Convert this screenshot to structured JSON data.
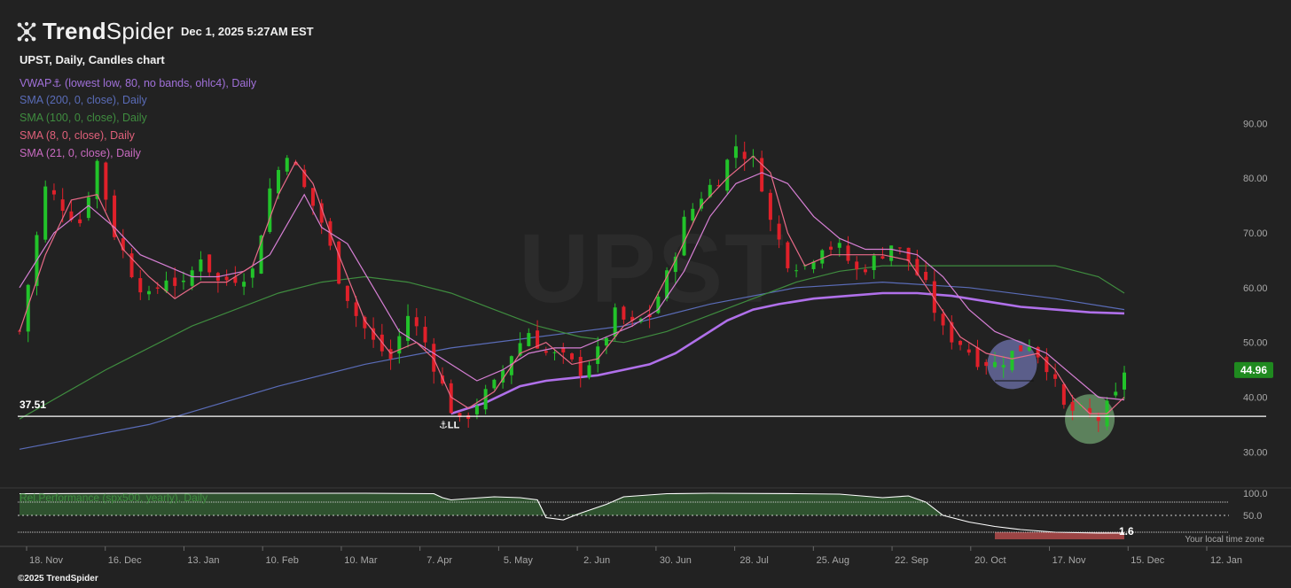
{
  "header": {
    "brand_bold": "Trend",
    "brand_light": "Spider",
    "timestamp": "Dec 1, 2025 5:27AM EST",
    "chart_title": "UPST, Daily, Candles chart",
    "watermark": "UPST"
  },
  "legend": [
    {
      "label": "VWAP⚓ (lowest low, 80, no bands, ohlc4), Daily",
      "color": "#a070d8"
    },
    {
      "label": "SMA (200, 0, close), Daily",
      "color": "#5a6cb8"
    },
    {
      "label": "SMA (100, 0, close), Daily",
      "color": "#3f8c3f"
    },
    {
      "label": "SMA (8, 0, close), Daily",
      "color": "#e0607a"
    },
    {
      "label": "SMA (21, 0, close), Daily",
      "color": "#c86ac0"
    }
  ],
  "price_axis": {
    "ticks": [
      90,
      80,
      70,
      60,
      50,
      40,
      30
    ],
    "tick_labels": [
      "90.00",
      "80.00",
      "70.00",
      "60.00",
      "50.00",
      "40.00",
      "30.00"
    ],
    "min": 26.5,
    "max": 97
  },
  "last_price": {
    "label": "44.96",
    "value": 44.96,
    "color": "#1f8a1f"
  },
  "support_line": {
    "label": "37.51",
    "value": 36.5
  },
  "anchor_label": "⚓LL",
  "rel_perf": {
    "label": "Rel.Performance (spx500, yearly), Daily",
    "levels": [
      "100.0",
      "50.0"
    ],
    "last_label": "1.6"
  },
  "x_axis": {
    "labels": [
      "18. Nov",
      "16. Dec",
      "13. Jan",
      "10. Feb",
      "10. Mar",
      "7. Apr",
      "5. May",
      "2. Jun",
      "30. Jun",
      "28. Jul",
      "25. Aug",
      "22. Sep",
      "20. Oct",
      "17. Nov",
      "15. Dec",
      "12. Jan"
    ]
  },
  "footer": {
    "copyright": "©2025 TrendSpider",
    "local_time": "Your local time zone"
  },
  "colors": {
    "up": "#22c32a",
    "down": "#e0202a",
    "bg": "#222222"
  },
  "chart_data": {
    "type": "candlestick",
    "title": "UPST, Daily, Candles chart",
    "ylim": [
      26.5,
      97
    ],
    "x": [
      "18. Nov",
      "16. Dec",
      "13. Jan",
      "10. Feb",
      "10. Mar",
      "7. Apr",
      "5. May",
      "2. Jun",
      "30. Jun",
      "28. Jul",
      "25. Aug",
      "22. Sep",
      "20. Oct",
      "17. Nov",
      "15. Dec",
      "12. Jan"
    ],
    "close_path": [
      [
        0,
        52
      ],
      [
        3,
        78
      ],
      [
        5,
        75
      ],
      [
        7,
        72
      ],
      [
        9,
        83
      ],
      [
        11,
        70
      ],
      [
        13,
        63
      ],
      [
        15,
        58
      ],
      [
        17,
        62
      ],
      [
        19,
        60
      ],
      [
        21,
        66
      ],
      [
        23,
        61
      ],
      [
        25,
        62
      ],
      [
        27,
        63
      ],
      [
        29,
        78
      ],
      [
        31,
        85
      ],
      [
        33,
        78
      ],
      [
        35,
        72
      ],
      [
        37,
        62
      ],
      [
        39,
        55
      ],
      [
        41,
        50
      ],
      [
        43,
        47
      ],
      [
        45,
        55
      ],
      [
        47,
        50
      ],
      [
        49,
        42
      ],
      [
        50,
        38
      ],
      [
        51,
        35
      ],
      [
        53,
        39
      ],
      [
        55,
        42
      ],
      [
        57,
        48
      ],
      [
        59,
        52
      ],
      [
        61,
        48
      ],
      [
        63,
        47
      ],
      [
        65,
        45
      ],
      [
        67,
        48
      ],
      [
        69,
        55
      ],
      [
        71,
        53
      ],
      [
        73,
        55
      ],
      [
        75,
        62
      ],
      [
        77,
        72
      ],
      [
        79,
        77
      ],
      [
        81,
        80
      ],
      [
        83,
        86
      ],
      [
        85,
        83
      ],
      [
        86,
        79
      ],
      [
        87,
        72
      ],
      [
        89,
        65
      ],
      [
        91,
        64
      ],
      [
        93,
        68
      ],
      [
        95,
        67
      ],
      [
        97,
        63
      ],
      [
        99,
        65
      ],
      [
        101,
        68
      ],
      [
        103,
        65
      ],
      [
        105,
        60
      ],
      [
        107,
        52
      ],
      [
        109,
        50
      ],
      [
        111,
        47
      ],
      [
        113,
        46
      ],
      [
        115,
        48
      ],
      [
        117,
        50
      ],
      [
        119,
        46
      ],
      [
        121,
        38
      ],
      [
        123,
        37
      ],
      [
        125,
        36
      ],
      [
        127,
        40
      ],
      [
        128,
        44.96
      ]
    ],
    "series": [
      {
        "name": "SMA (8, 0, close), Daily",
        "values": [
          [
            0,
            52
          ],
          [
            3,
            66
          ],
          [
            6,
            76
          ],
          [
            9,
            77
          ],
          [
            12,
            67
          ],
          [
            15,
            62
          ],
          [
            18,
            58
          ],
          [
            21,
            61
          ],
          [
            24,
            61
          ],
          [
            27,
            64
          ],
          [
            30,
            77
          ],
          [
            32,
            83
          ],
          [
            34,
            79
          ],
          [
            36,
            70
          ],
          [
            38,
            62
          ],
          [
            40,
            54
          ],
          [
            43,
            48
          ],
          [
            46,
            50
          ],
          [
            48,
            47
          ],
          [
            50,
            40
          ],
          [
            52,
            38
          ],
          [
            55,
            41
          ],
          [
            58,
            48
          ],
          [
            61,
            50
          ],
          [
            64,
            46
          ],
          [
            67,
            47
          ],
          [
            70,
            53
          ],
          [
            73,
            56
          ],
          [
            76,
            65
          ],
          [
            79,
            75
          ],
          [
            82,
            80
          ],
          [
            85,
            84
          ],
          [
            87,
            81
          ],
          [
            89,
            70
          ],
          [
            91,
            64
          ],
          [
            94,
            66
          ],
          [
            97,
            66
          ],
          [
            100,
            66
          ],
          [
            103,
            65
          ],
          [
            106,
            58
          ],
          [
            109,
            51
          ],
          [
            112,
            48
          ],
          [
            115,
            47
          ],
          [
            118,
            48
          ],
          [
            120,
            45
          ],
          [
            122,
            40
          ],
          [
            124,
            37
          ],
          [
            126,
            37
          ],
          [
            128,
            40
          ]
        ]
      },
      {
        "name": "SMA (21, 0, close), Daily",
        "values": [
          [
            0,
            60
          ],
          [
            4,
            70
          ],
          [
            8,
            75
          ],
          [
            11,
            71
          ],
          [
            14,
            66
          ],
          [
            17,
            64
          ],
          [
            20,
            62
          ],
          [
            23,
            62
          ],
          [
            26,
            63
          ],
          [
            29,
            66
          ],
          [
            33,
            77
          ],
          [
            35,
            71
          ],
          [
            38,
            68
          ],
          [
            41,
            60
          ],
          [
            44,
            52
          ],
          [
            47,
            49
          ],
          [
            50,
            46
          ],
          [
            53,
            43
          ],
          [
            56,
            45
          ],
          [
            59,
            48
          ],
          [
            62,
            49
          ],
          [
            65,
            49
          ],
          [
            68,
            51
          ],
          [
            71,
            53
          ],
          [
            74,
            56
          ],
          [
            77,
            63
          ],
          [
            80,
            73
          ],
          [
            83,
            79
          ],
          [
            86,
            81
          ],
          [
            89,
            79
          ],
          [
            92,
            73
          ],
          [
            95,
            69
          ],
          [
            98,
            67
          ],
          [
            101,
            67
          ],
          [
            104,
            66
          ],
          [
            107,
            62
          ],
          [
            110,
            56
          ],
          [
            113,
            52
          ],
          [
            116,
            50
          ],
          [
            119,
            48
          ],
          [
            122,
            44
          ],
          [
            125,
            40
          ],
          [
            128,
            39.5
          ]
        ]
      },
      {
        "name": "SMA (100, 0, close), Daily",
        "values": [
          [
            0,
            36
          ],
          [
            10,
            45
          ],
          [
            20,
            53
          ],
          [
            30,
            59
          ],
          [
            35,
            61
          ],
          [
            40,
            62
          ],
          [
            45,
            61
          ],
          [
            50,
            59
          ],
          [
            55,
            56
          ],
          [
            60,
            53
          ],
          [
            65,
            51
          ],
          [
            70,
            50
          ],
          [
            75,
            52
          ],
          [
            80,
            55
          ],
          [
            85,
            58
          ],
          [
            90,
            61
          ],
          [
            95,
            63
          ],
          [
            100,
            64
          ],
          [
            105,
            64
          ],
          [
            110,
            64
          ],
          [
            115,
            64
          ],
          [
            120,
            64
          ],
          [
            125,
            62
          ],
          [
            128,
            59
          ]
        ]
      },
      {
        "name": "SMA (200, 0, close), Daily",
        "values": [
          [
            0,
            30.5
          ],
          [
            15,
            35
          ],
          [
            30,
            42
          ],
          [
            40,
            46
          ],
          [
            50,
            49
          ],
          [
            60,
            51
          ],
          [
            70,
            53
          ],
          [
            80,
            57
          ],
          [
            90,
            60
          ],
          [
            100,
            61
          ],
          [
            110,
            60
          ],
          [
            120,
            58
          ],
          [
            128,
            56
          ]
        ]
      },
      {
        "name": "VWAP⚓ (lowest low, 80, no bands, ohlc4), Daily",
        "values": [
          [
            50,
            37
          ],
          [
            54,
            39
          ],
          [
            58,
            42
          ],
          [
            61,
            43
          ],
          [
            64,
            43.5
          ],
          [
            67,
            44
          ],
          [
            70,
            45
          ],
          [
            73,
            46
          ],
          [
            76,
            48
          ],
          [
            79,
            51
          ],
          [
            82,
            54
          ],
          [
            85,
            56
          ],
          [
            88,
            57
          ],
          [
            92,
            58
          ],
          [
            96,
            58.5
          ],
          [
            100,
            59
          ],
          [
            104,
            59
          ],
          [
            108,
            58.5
          ],
          [
            112,
            57.5
          ],
          [
            116,
            56.5
          ],
          [
            120,
            56
          ],
          [
            124,
            55.5
          ],
          [
            128,
            55.3
          ]
        ]
      }
    ],
    "rel_performance": [
      [
        0,
        99
      ],
      [
        20,
        100
      ],
      [
        40,
        100
      ],
      [
        48,
        99
      ],
      [
        49,
        90
      ],
      [
        50,
        85
      ],
      [
        52,
        88
      ],
      [
        55,
        92
      ],
      [
        58,
        90
      ],
      [
        60,
        85
      ],
      [
        61,
        45
      ],
      [
        63,
        40
      ],
      [
        65,
        55
      ],
      [
        68,
        75
      ],
      [
        70,
        92
      ],
      [
        75,
        99
      ],
      [
        80,
        100
      ],
      [
        90,
        99
      ],
      [
        95,
        98
      ],
      [
        100,
        90
      ],
      [
        103,
        94
      ],
      [
        105,
        80
      ],
      [
        107,
        50
      ],
      [
        110,
        35
      ],
      [
        113,
        25
      ],
      [
        116,
        18
      ],
      [
        120,
        12
      ],
      [
        125,
        10
      ],
      [
        128,
        10
      ]
    ],
    "highlights": [
      {
        "type": "circle",
        "at": [
          115,
          46
        ],
        "color": "#8a8fe0"
      },
      {
        "type": "circle",
        "at": [
          124,
          36
        ],
        "color": "#8ccf8c"
      }
    ]
  }
}
